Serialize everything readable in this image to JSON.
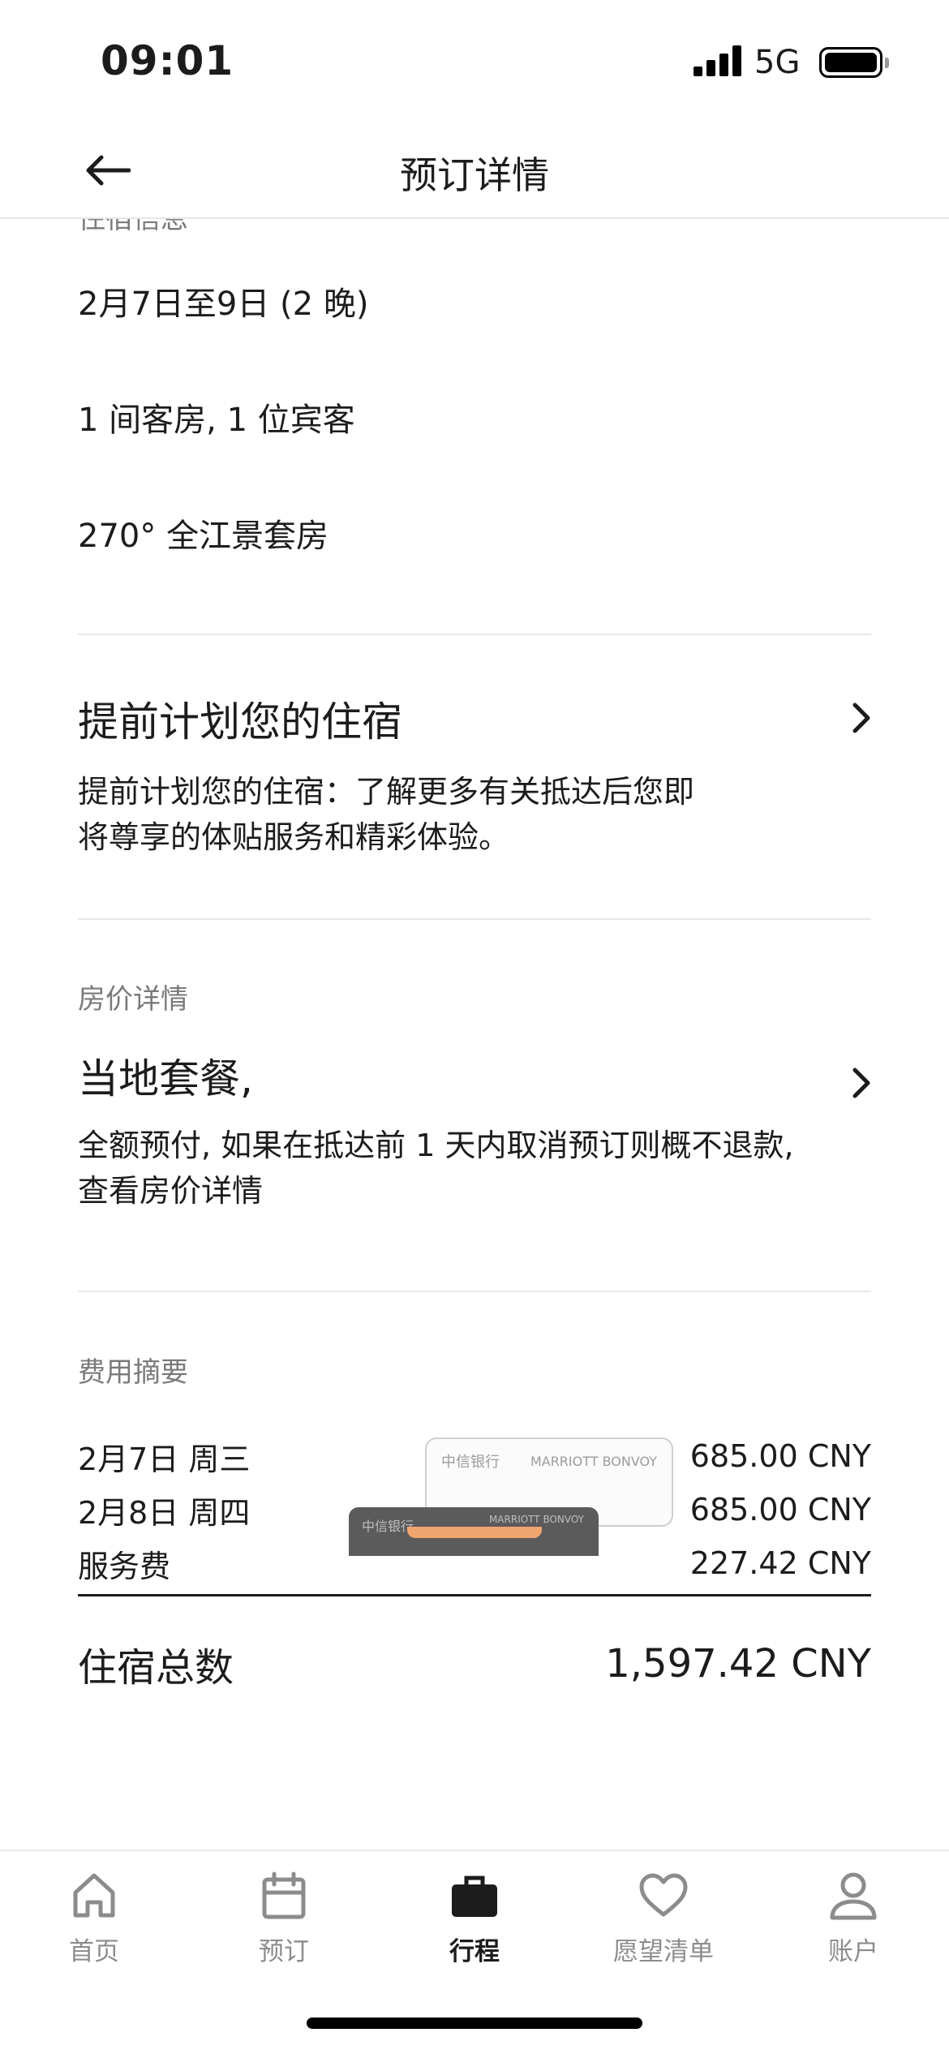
{
  "status_bar": {
    "time": "09:01",
    "network": "5G"
  },
  "header": {
    "title": "预订详情"
  },
  "stay_info": {
    "section_label": "住宿信息",
    "dates": "2月7日至9日 (2 晚)",
    "rooms_guests": "1 间客房, 1 位宾客",
    "room_type": "270° 全江景套房"
  },
  "plan_ahead": {
    "title": "提前计划您的住宿",
    "desc_line1": "提前计划您的住宿：了解更多有关抵达后您即",
    "desc_line2": "将尊享的体贴服务和精彩体验。"
  },
  "rate_details": {
    "label": "房价详情",
    "title": "当地套餐,",
    "desc_line1": "全额预付, 如果在抵达前 1 天内取消预订则概不退款,",
    "desc_line2": "查看房价详情"
  },
  "fee_summary": {
    "label": "费用摘要",
    "rows": [
      {
        "label": "2月7日 周三",
        "amount": "685.00 CNY"
      },
      {
        "label": "2月8日 周四",
        "amount": "685.00 CNY"
      },
      {
        "label": "服务费",
        "amount": "227.42 CNY"
      }
    ],
    "total_label": "住宿总数",
    "total_amount": "1,597.42 CNY"
  },
  "promo_card": {
    "bank_name": "中信银行",
    "brand": "MARRIOTT BONVOY"
  },
  "tab_bar": {
    "tabs": [
      {
        "label": "首页",
        "icon": "home-icon"
      },
      {
        "label": "预订",
        "icon": "calendar-icon"
      },
      {
        "label": "行程",
        "icon": "briefcase-icon",
        "active": true
      },
      {
        "label": "愿望清单",
        "icon": "heart-icon"
      },
      {
        "label": "账户",
        "icon": "person-icon"
      }
    ]
  }
}
